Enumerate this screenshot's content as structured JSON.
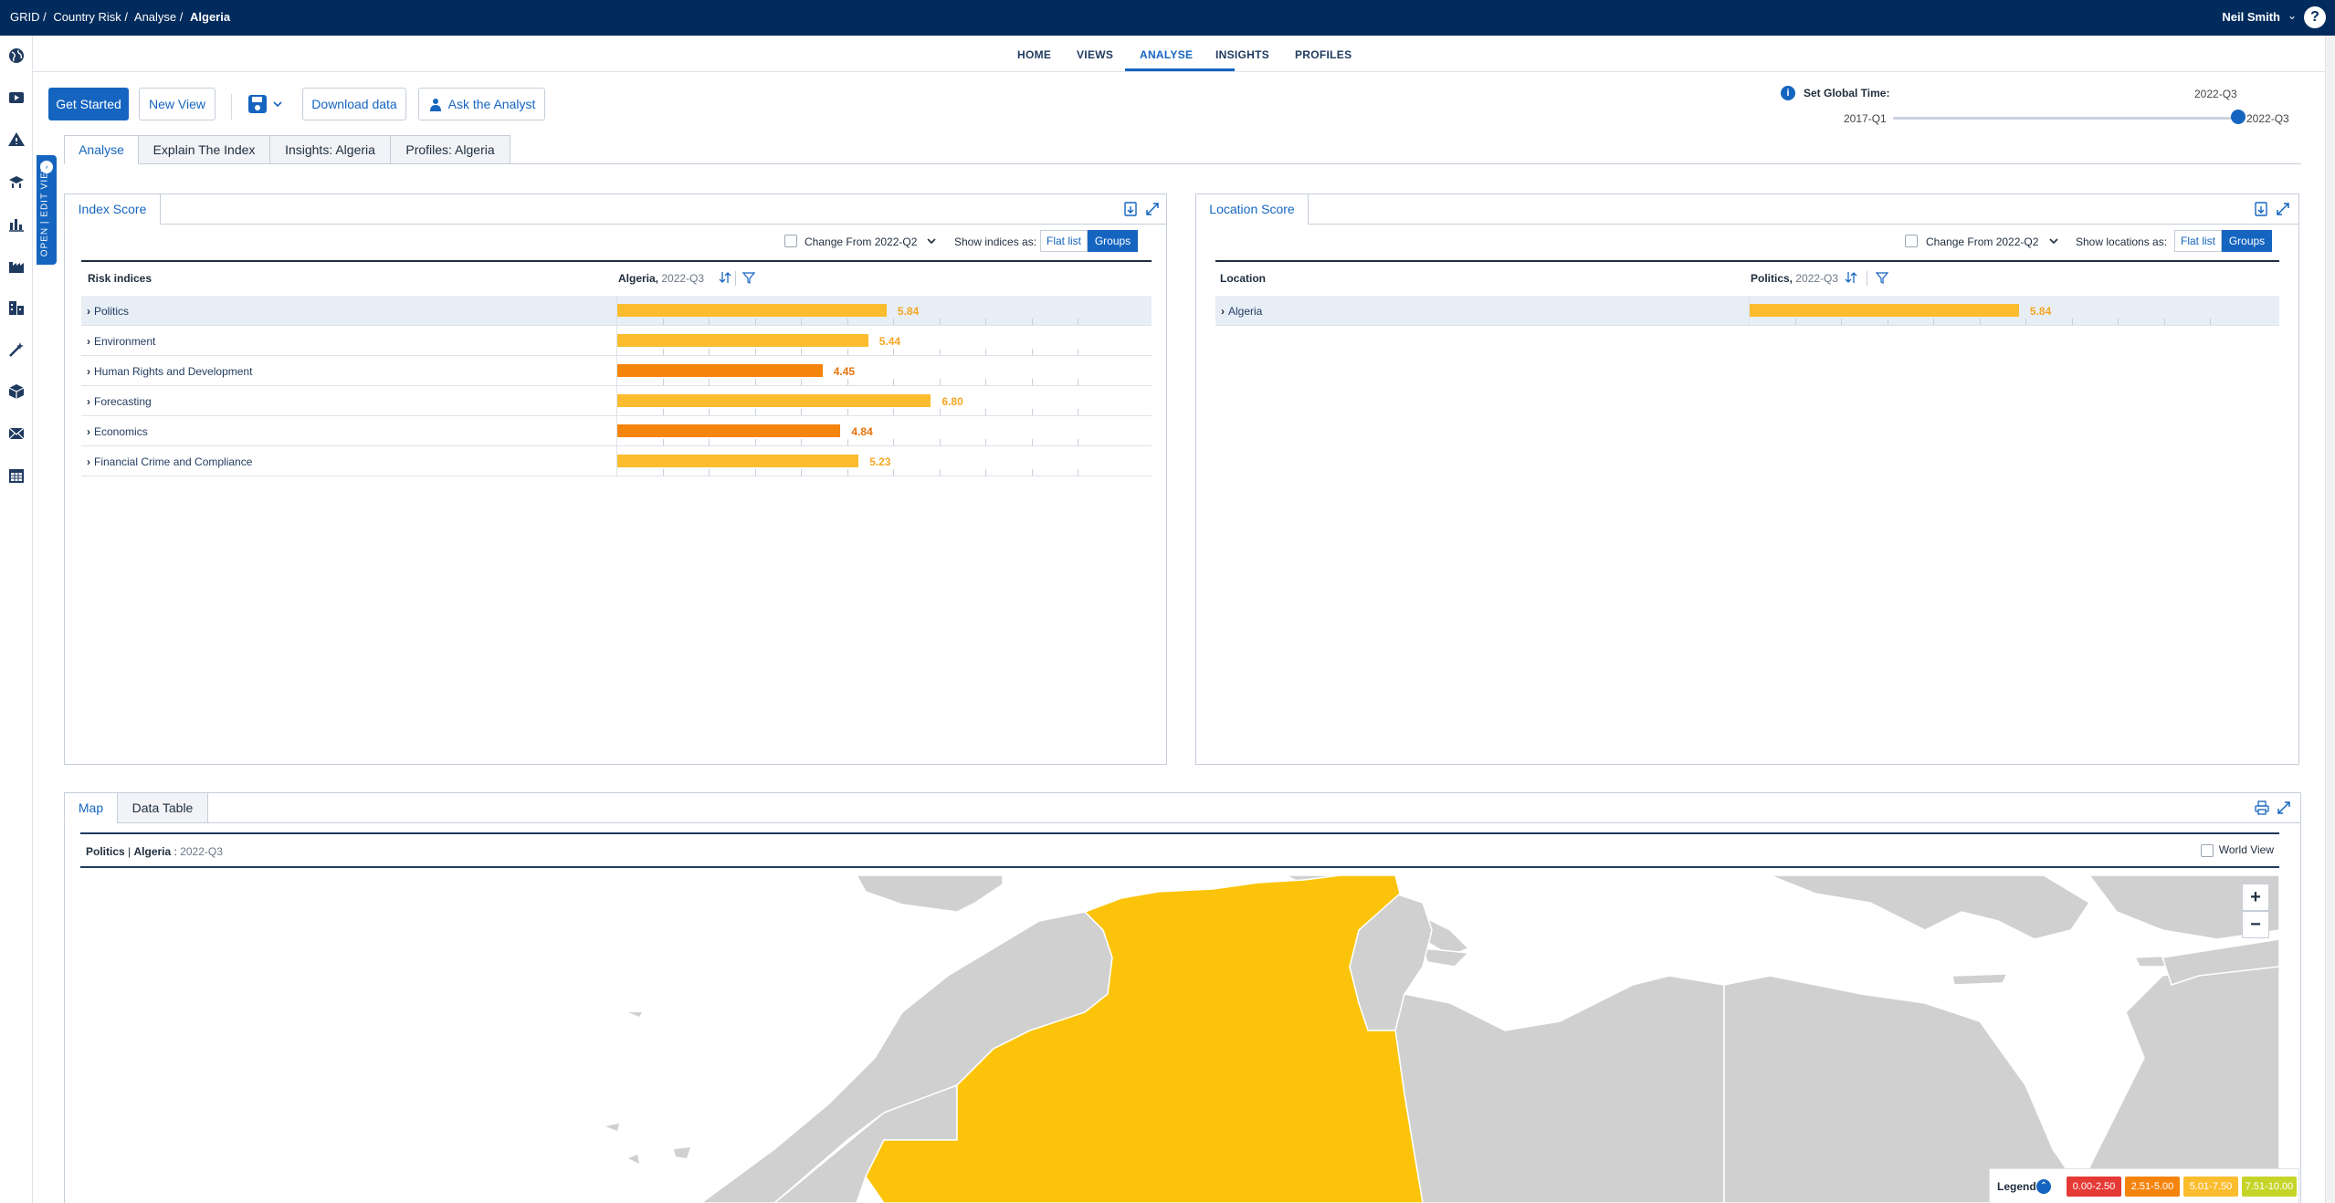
{
  "topbar": {
    "breadcrumbs": [
      "GRID /",
      "Country Risk /",
      "Analyse /"
    ],
    "current": "Algeria",
    "user": "Neil Smith",
    "user_chevron": "⌄",
    "help": "?"
  },
  "sidebar": {
    "icons": [
      "globe-icon",
      "video-icon",
      "alert-triangle-icon",
      "satellite-icon",
      "chart-bars-icon",
      "factory-icon",
      "buildings-icon",
      "magic-wand-icon",
      "cube-icon",
      "envelope-icon",
      "calendar-icon"
    ],
    "open_edit_label": "OPEN | EDIT VIEW"
  },
  "nav": {
    "items": [
      {
        "label": "HOME",
        "active": false
      },
      {
        "label": "VIEWS",
        "active": false
      },
      {
        "label": "ANALYSE",
        "active": true
      },
      {
        "label": "INSIGHTS",
        "active": false
      },
      {
        "label": "PROFILES",
        "active": false
      }
    ]
  },
  "toolbar": {
    "get_started": "Get Started",
    "new_view": "New View",
    "download": "Download data",
    "ask_analyst": "Ask the Analyst"
  },
  "global_time": {
    "label": "Set Global Time:",
    "value": "2022-Q3",
    "start": "2017-Q1",
    "end": "2022-Q3",
    "position": 1.0
  },
  "view_tabs": [
    {
      "label": "Analyse",
      "active": true
    },
    {
      "label": "Explain The Index",
      "active": false
    },
    {
      "label": "Insights: Algeria",
      "active": false
    },
    {
      "label": "Profiles: Algeria",
      "active": false
    }
  ],
  "index_panel": {
    "tab": "Index Score",
    "change_label": "Change From 2022-Q2",
    "show_label": "Show indices as:",
    "flat_list": "Flat list",
    "groups": "Groups",
    "col_name": "Risk indices",
    "col_value": "Algeria,",
    "col_value_sub": "2022-Q3",
    "rows": [
      {
        "label": "Politics",
        "value": 5.84,
        "display": "5.84",
        "color": "#fbbc2e",
        "text_color": "#f5a623",
        "selected": true
      },
      {
        "label": "Environment",
        "value": 5.44,
        "display": "5.44",
        "color": "#fbbc2e",
        "text_color": "#f5a623",
        "selected": false
      },
      {
        "label": "Human Rights and Development",
        "value": 4.45,
        "display": "4.45",
        "color": "#f5840c",
        "text_color": "#e6720a",
        "selected": false
      },
      {
        "label": "Forecasting",
        "value": 6.8,
        "display": "6.80",
        "color": "#fbbc2e",
        "text_color": "#f5a623",
        "selected": false
      },
      {
        "label": "Economics",
        "value": 4.84,
        "display": "4.84",
        "color": "#f5840c",
        "text_color": "#e6720a",
        "selected": false
      },
      {
        "label": "Financial Crime and Compliance",
        "value": 5.23,
        "display": "5.23",
        "color": "#fbbc2e",
        "text_color": "#f5a623",
        "selected": false
      }
    ]
  },
  "location_panel": {
    "tab": "Location Score",
    "change_label": "Change From 2022-Q2",
    "show_label": "Show locations as:",
    "flat_list": "Flat list",
    "groups": "Groups",
    "col_name": "Location",
    "col_value": "Politics,",
    "col_value_sub": "2022-Q3",
    "rows": [
      {
        "label": "Algeria",
        "value": 5.84,
        "display": "5.84",
        "color": "#fbbc2e",
        "text_color": "#f5a623",
        "selected": true
      }
    ]
  },
  "map_panel": {
    "tabs": [
      {
        "label": "Map",
        "active": true
      },
      {
        "label": "Data Table",
        "active": false
      }
    ],
    "title_index": "Politics",
    "title_sep": " | ",
    "title_country": "Algeria",
    "title_colon": " : ",
    "title_period": "2022-Q3",
    "world_view": "World View",
    "zoom_in": "+",
    "zoom_out": "−",
    "legend_title": "Legend",
    "legend": [
      {
        "label": "0.00-2.50",
        "color": "#e53935"
      },
      {
        "label": "2.51-5.00",
        "color": "#f5840c"
      },
      {
        "label": "5.01-7.50",
        "color": "#fbbc2e"
      },
      {
        "label": "7.51-10.00",
        "color": "#c6d42a"
      }
    ],
    "highlight_color": "#fbc40a",
    "land_color": "#d0d0d0"
  }
}
